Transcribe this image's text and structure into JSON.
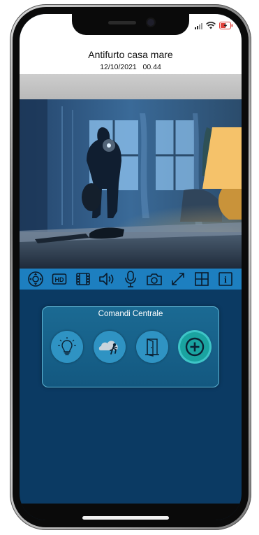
{
  "header": {
    "title": "Antifurto casa mare",
    "datetime": "12/10/2021   00.44"
  },
  "video": {
    "scene": "intruder-with-flashlight-in-living-room"
  },
  "toolbar": {
    "icons": [
      "ptz-icon",
      "hd-icon",
      "film-icon",
      "speaker-icon",
      "microphone-icon",
      "camera-icon",
      "fullscreen-icon",
      "grid-icon",
      "info-icon"
    ],
    "hd_label": "HD",
    "info_label": "i"
  },
  "panel": {
    "title": "Comandi Centrale",
    "commands": [
      "light-bulb-icon",
      "intruder-alarm-icon",
      "door-icon",
      "add-icon"
    ]
  },
  "colors": {
    "header_bg": "#ffffff",
    "toolbar_bg": "#1d7fc0",
    "app_bg": "#0b3a63",
    "panel_bg": "#1b6a93",
    "panel_border": "#5fb7d6",
    "command_bg": "#2f93c3",
    "add_bg": "#1aa3a0"
  }
}
